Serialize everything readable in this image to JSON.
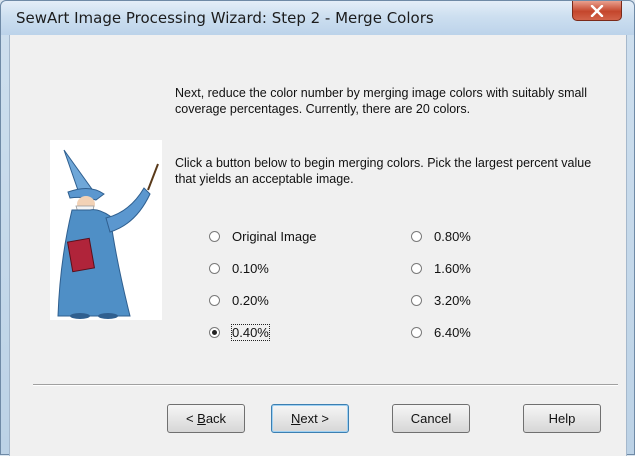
{
  "window": {
    "title": "SewArt Image Processing Wizard: Step 2 - Merge Colors"
  },
  "instructions": {
    "para1": "Next, reduce the color number by merging image colors  with suitably small coverage percentages. Currently, there are 20 colors.",
    "para2": "Click a button below to begin merging colors. Pick the largest percent value that yields an acceptable image."
  },
  "options": {
    "left": [
      {
        "label": "Original Image",
        "checked": false
      },
      {
        "label": "0.10%",
        "checked": false
      },
      {
        "label": "0.20%",
        "checked": false
      },
      {
        "label": "0.40%",
        "checked": true
      }
    ],
    "right": [
      {
        "label": "0.80%",
        "checked": false
      },
      {
        "label": "1.60%",
        "checked": false
      },
      {
        "label": "3.20%",
        "checked": false
      },
      {
        "label": "6.40%",
        "checked": false
      }
    ]
  },
  "buttons": {
    "back": {
      "prefix": "< ",
      "mnemonic": "B",
      "rest": "ack"
    },
    "next": {
      "mnemonic": "N",
      "rest": "ext >"
    },
    "cancel": "Cancel",
    "help": "Help"
  },
  "colors": {
    "wizard_robe": "#4f8fc6",
    "wizard_hat": "#6fa7d8",
    "book": "#b0243a",
    "beard": "#f4f4f4"
  },
  "icons": {
    "close": "close-icon",
    "wizard": "wizard-illustration"
  }
}
